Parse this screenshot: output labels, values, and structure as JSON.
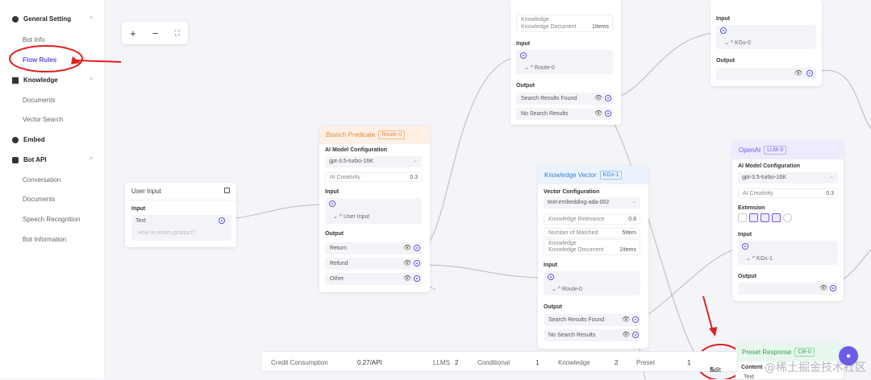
{
  "sidebar": {
    "general_setting": "General Setting",
    "bot_info": "Bot Info",
    "flow_rules": "Flow Rules",
    "knowledge": "Knowledge",
    "documents": "Documents",
    "vector_search": "Vector Search",
    "embed": "Embed",
    "bot_api": "Bot API",
    "conversation": "Conversation",
    "documents_api": "Documents",
    "speech_recognition": "Speech Recognition",
    "bot_information": "Bot Information"
  },
  "zoom": {
    "plus": "+",
    "minus": "−",
    "fit": "⛶"
  },
  "user_input": {
    "title": "User Input",
    "input_label": "Input",
    "text": "Text",
    "placeholder": "How to return product?"
  },
  "branch": {
    "title": "Branch Predicate",
    "tag": "Route-0",
    "ai_cfg": "AI Model Configuration",
    "model": "gpt-3.5-turbo-16K",
    "creativity_label": "AI Creativity",
    "creativity_value": "0.3",
    "input_label": "Input",
    "input_source": "User Input",
    "output_label": "Output",
    "out1": "Return",
    "out2": "Refund",
    "out3": "Other"
  },
  "kv_top": {
    "k1": "Knowledge",
    "k2": "Knowledge Document",
    "k2_val": "1Items",
    "input_label": "Input",
    "input_source": "Route-0",
    "output_label": "Output",
    "out1": "Search Results Found",
    "out2": "No Search Results"
  },
  "kv1": {
    "title": "Knowledge Vector",
    "tag": "KGs-1",
    "vec_cfg": "Vector Configuration",
    "model": "text-embedding-ada-002",
    "relevance_label": "Knowledge Relevance",
    "relevance_val": "0.8",
    "matched_label": "Number of Matched",
    "matched_val": "5Item",
    "doc_label1": "Knowledge",
    "doc_label2": "Knowledge Document",
    "doc_val": "1Items",
    "input_label": "Input",
    "input_source": "Route-0",
    "output_label": "Output",
    "out1": "Search Results Found",
    "out2": "No Search Results"
  },
  "right_top": {
    "input_label": "Input",
    "input_source": "KGs-0",
    "output_label": "Output"
  },
  "openai": {
    "title": "OpenAI",
    "tag": "LLM-3",
    "ai_cfg": "AI Model Configuration",
    "model": "gpt-3.5-turbo-16K",
    "creativity_label": "AI Creativity",
    "creativity_value": "0.3",
    "ext_label": "Extension",
    "input_label": "Input",
    "input_source": "KGs-1",
    "output_label": "Output"
  },
  "preset": {
    "title": "Preset Response",
    "tag": "CR-0",
    "content": "Content",
    "text": "Text"
  },
  "status": {
    "credit_label": "Credit Consumption",
    "credit_val": "0.27/API",
    "llms_label": "LLMS",
    "llms_val": "2",
    "cond_label": "Conditional",
    "cond_val": "1",
    "know_label": "Knowledge",
    "know_val": "2",
    "preset_label": "Preset",
    "preset_val": "1",
    "edit": "Edit"
  },
  "watermark": "@稀土掘金技术社区",
  "colors": {
    "accent": "#5b4fe0",
    "annotation": "#e02020"
  }
}
